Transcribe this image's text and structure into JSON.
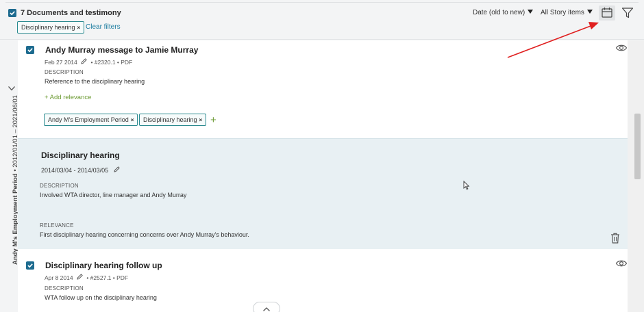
{
  "header": {
    "title": "7 Documents and testimony",
    "filter_chip": "Disciplinary hearing",
    "chip_remove": "×",
    "clear_filters": "Clear filters",
    "sort_label": "Date (old to new)",
    "items_label": "All Story items"
  },
  "rail": {
    "period_label": "Andy M's Employment Period",
    "period_range": " • 2012/01/01 – 2021/06/01"
  },
  "cards": [
    {
      "title": "Andy Murray message to Jamie Murray",
      "date": "Feb 27 2014",
      "ref": "• #2320.1 • PDF",
      "desc_label": "DESCRIPTION",
      "desc": "Reference to the disciplinary hearing",
      "add_relevance": "+ Add relevance",
      "tags": [
        "Andy M's Employment Period",
        "Disciplinary hearing"
      ],
      "add_tag": "+"
    },
    {
      "title": "Disciplinary hearing",
      "date_range": "2014/03/04 - 2014/03/05",
      "desc_label": "DESCRIPTION",
      "desc": "Involved WTA director, line manager and Andy Murray",
      "rel_label": "RELEVANCE",
      "rel": "First disciplinary hearing concerning concerns over Andy Murray's behaviour."
    },
    {
      "title": "Disciplinary hearing follow up",
      "date": "Apr 8 2014",
      "ref": "• #2527.1 • PDF",
      "desc_label": "DESCRIPTION",
      "desc": "WTA follow up on the disciplinary hearing"
    }
  ],
  "colors": {
    "accent": "#1d6b8f",
    "chip_border": "#2a8a8f",
    "link": "#1a7b9f",
    "add_green": "#6d9b34",
    "annotation_arrow": "#e02020"
  },
  "icons": [
    "checkbox-checked-icon",
    "calendar-icon",
    "filter-icon",
    "eye-icon",
    "pencil-icon",
    "trash-icon",
    "chevron-down-icon",
    "chevron-up-icon",
    "mouse-cursor-icon"
  ]
}
